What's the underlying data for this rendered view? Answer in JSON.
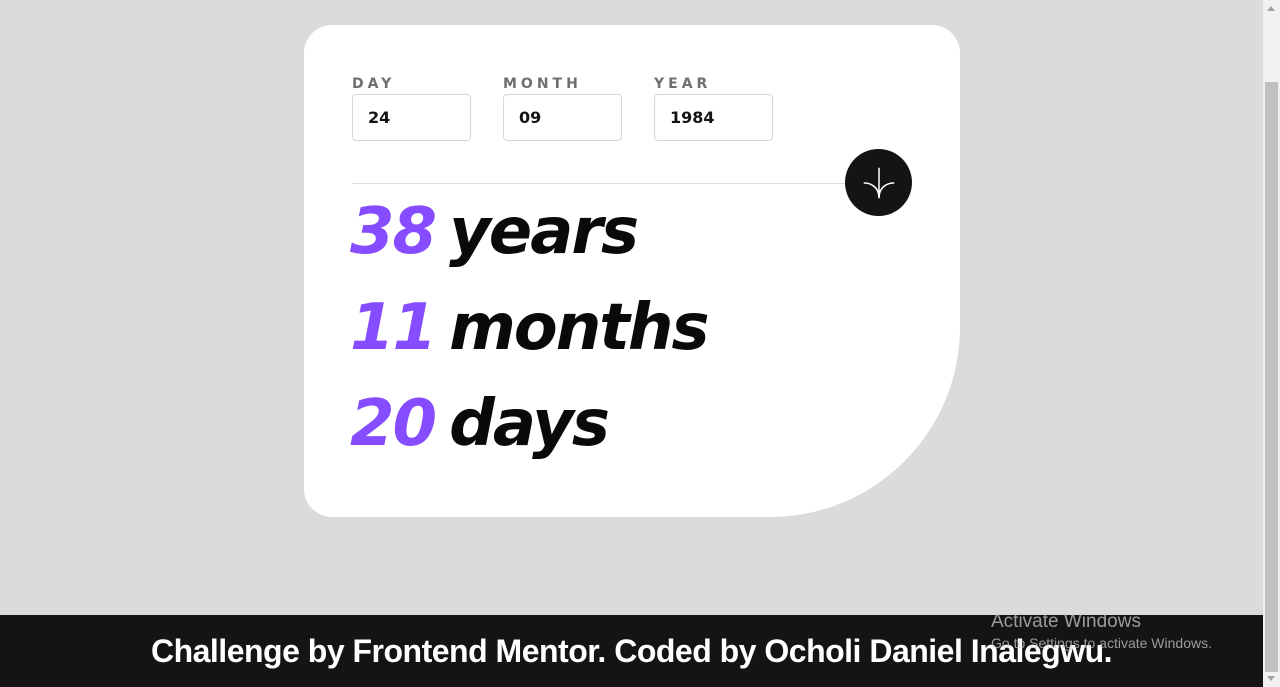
{
  "form": {
    "day": {
      "label": "DAY",
      "value": "24"
    },
    "month": {
      "label": "MONTH",
      "value": "09"
    },
    "year": {
      "label": "YEAR",
      "value": "1984"
    },
    "submit_icon": "arrow-down-icon"
  },
  "results": {
    "years": {
      "value": "38",
      "unit": "years"
    },
    "months": {
      "value": "11",
      "unit": "months"
    },
    "days": {
      "value": "20",
      "unit": "days"
    }
  },
  "footer": {
    "text": "Challenge by Frontend Mentor. Coded by Ocholi Daniel Inalegwu."
  },
  "watermark": {
    "title": "Activate Windows",
    "subtitle": "Go to Settings to activate Windows."
  },
  "colors": {
    "accent": "#854dff",
    "background": "#dbdbdb",
    "card": "#ffffff",
    "button": "#141414",
    "footer": "#141414"
  }
}
